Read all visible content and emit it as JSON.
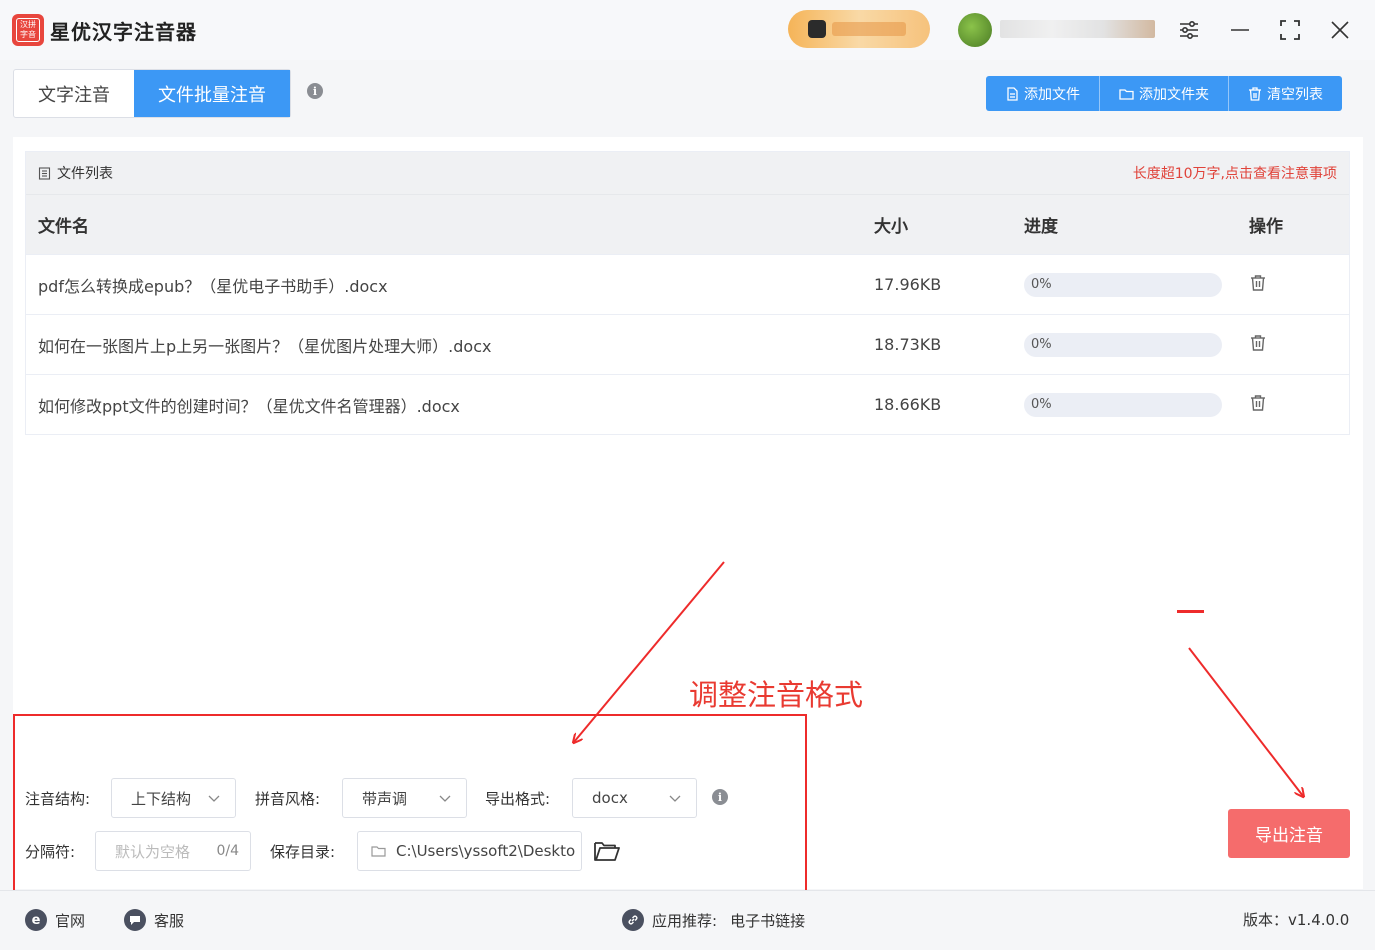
{
  "app": {
    "title": "星优汉字注音器",
    "logo_text": "汉拼字音"
  },
  "tabs": [
    {
      "label": "文字注音",
      "active": false
    },
    {
      "label": "文件批量注音",
      "active": true
    }
  ],
  "toolbar": {
    "add_file": "添加文件",
    "add_folder": "添加文件夹",
    "clear_list": "清空列表"
  },
  "file_list": {
    "title": "文件列表",
    "notice": "长度超10万字,点击查看注意事项",
    "columns": {
      "name": "文件名",
      "size": "大小",
      "progress": "进度",
      "action": "操作"
    },
    "rows": [
      {
        "name": "pdf怎么转换成epub？（星优电子书助手）.docx",
        "size": "17.96KB",
        "progress": "0%",
        "progress_value": 0
      },
      {
        "name": "如何在一张图片上p上另一张图片？（星优图片处理大师）.docx",
        "size": "18.73KB",
        "progress": "0%",
        "progress_value": 0
      },
      {
        "name": "如何修改ppt文件的创建时间？（星优文件名管理器）.docx",
        "size": "18.66KB",
        "progress": "0%",
        "progress_value": 0
      }
    ]
  },
  "settings": {
    "structure_label": "注音结构:",
    "structure_value": "上下结构",
    "style_label": "拼音风格:",
    "style_value": "带声调",
    "format_label": "导出格式:",
    "format_value": "docx",
    "separator_label": "分隔符:",
    "separator_placeholder": "默认为空格",
    "separator_count": "0/4",
    "save_dir_label": "保存目录:",
    "save_dir_value": "C:\\Users\\yssoft2\\Deskto"
  },
  "export_button": "导出注音",
  "annotation": {
    "text": "调整注音格式",
    "color": "#e93a31"
  },
  "footer": {
    "website": "官网",
    "support": "客服",
    "recommend_label": "应用推荐:",
    "recommend_link": "电子书链接",
    "version": "版本：v1.4.0.0"
  },
  "colors": {
    "primary": "#3c98f5",
    "danger": "#f56c6c",
    "annotation": "#ee2b2b"
  },
  "icons": {
    "window": [
      "settings-sliders-icon",
      "minimize-icon",
      "maximize-icon",
      "close-icon"
    ],
    "toolbar": [
      "file-icon",
      "folder-icon",
      "trash-icon"
    ],
    "row_action": "trash-icon",
    "footer": [
      "ie-icon",
      "chat-icon",
      "link-icon"
    ]
  }
}
